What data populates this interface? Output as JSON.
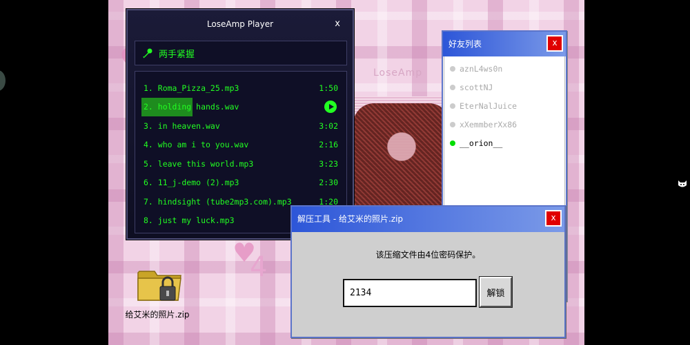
{
  "player": {
    "title": "LoseAmp Player",
    "close_label": "x",
    "now_playing": "两手紧握",
    "tracks": [
      {
        "name": "1. Roma_Pizza_25.mp3",
        "duration": "1:50"
      },
      {
        "name": "2. holding hands.wav",
        "duration": ""
      },
      {
        "name": "3. in heaven.wav",
        "duration": "3:02"
      },
      {
        "name": "4. who am i to you.wav",
        "duration": "2:16"
      },
      {
        "name": "5. leave this world.mp3",
        "duration": "3:23"
      },
      {
        "name": "6. 11_j-demo (2).mp3",
        "duration": "2:30"
      },
      {
        "name": "7. hindsight (tube2mp3.com).mp3",
        "duration": "1:20"
      },
      {
        "name": "8. just my luck.mp3",
        "duration": ""
      }
    ]
  },
  "friends": {
    "title": "好友列表",
    "close_label": "x",
    "items": [
      {
        "name": "aznL4ws0n",
        "status": "offline"
      },
      {
        "name": "scottNJ",
        "status": "offline"
      },
      {
        "name": "EterNalJuice",
        "status": "offline"
      },
      {
        "name": "xXemmberXx86",
        "status": "offline"
      },
      {
        "name": "__orion__",
        "status": "online"
      }
    ]
  },
  "unzip": {
    "title": "解压工具 - 给艾米的照片.zip",
    "close_label": "x",
    "message": "该压缩文件由4位密码保护。",
    "password_value": "2134",
    "unlock_label": "解锁"
  },
  "desktop": {
    "zip_file_label": "给艾米的照片.zip",
    "background_text": "LoseAmp",
    "background_number": "4"
  },
  "colors": {
    "player_text": "#22ff22",
    "titlebar_blue": "#2d56d8",
    "close_red": "#e00000",
    "online_dot": "#00dd00"
  }
}
